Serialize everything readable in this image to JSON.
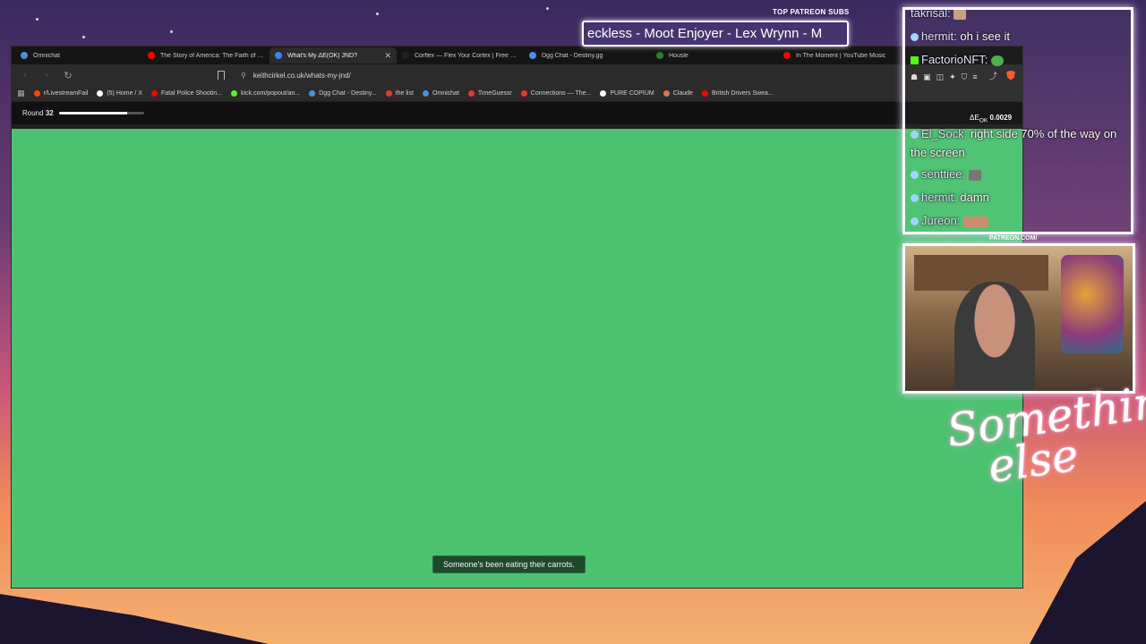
{
  "browser": {
    "tabs": [
      {
        "label": "Omnichat",
        "color": "#4a90e2",
        "active": false
      },
      {
        "label": "The Story of America: The Faith of Our...",
        "color": "#ff0000",
        "active": false
      },
      {
        "label": "What's My ΔE(OK) JND?",
        "color": "#3b82f6",
        "active": true
      },
      {
        "label": "Corflex — Flex Your Cortex | Free Brain...",
        "color": "#222222",
        "active": false
      },
      {
        "label": "Dgg Chat - Destiny.gg",
        "color": "#4a90e2",
        "active": false
      },
      {
        "label": "Housle",
        "color": "#2e7d32",
        "active": false
      },
      {
        "label": "In The Moment | YouTube Music",
        "color": "#ff0000",
        "active": false
      }
    ],
    "url": "keithcirkel.co.uk/whats-my-jnd/",
    "bookmarks": [
      {
        "label": "r/LivestreamFail",
        "color": "#ff4500"
      },
      {
        "label": "(5) Home / X",
        "color": "#ffffff"
      },
      {
        "label": "Fatal Police Shootin...",
        "color": "#ff0000"
      },
      {
        "label": "kick.com/popout/an...",
        "color": "#53fc18"
      },
      {
        "label": "Dgg Chat - Destiny...",
        "color": "#4a90e2"
      },
      {
        "label": "the list",
        "color": "#e53935"
      },
      {
        "label": "Omnichat",
        "color": "#4a90e2"
      },
      {
        "label": "TimeGuessr",
        "color": "#e53935"
      },
      {
        "label": "Connections — The...",
        "color": "#e53935"
      },
      {
        "label": "PURE COPIUM",
        "color": "#ffffff"
      },
      {
        "label": "Claude",
        "color": "#d97757"
      },
      {
        "label": "British Drivers Swea...",
        "color": "#ff0000"
      }
    ]
  },
  "game": {
    "round_prefix": "Round",
    "round_number": "32",
    "progress_fraction": 0.8,
    "stage_color": "#4cc271",
    "toast": "Someone's been eating their carrots."
  },
  "overlay": {
    "marquee_heading": "TOP PATREON SUBS",
    "marquee_text": "eckless - Moot Enjoyer - Lex Wrynn - M",
    "chat": [
      {
        "user": "takrisal:",
        "message": ""
      },
      {
        "user": "hermit:",
        "message": "oh i see it"
      },
      {
        "user": "FactorioNFT:",
        "message": ""
      },
      {
        "user": "El_Sock:",
        "message": "right side 70% of the way on the screen"
      },
      {
        "user": "senttiee:",
        "message": ""
      },
      {
        "user": "hermit:",
        "message": "damn"
      },
      {
        "user": "Jureon:",
        "message": ""
      }
    ],
    "delta_label": "ΔE",
    "delta_sub": "OK",
    "delta_value": "0.0029",
    "patreon_label": "PATREON.COM/",
    "brand_line1": "Something",
    "brand_line2": "else"
  }
}
